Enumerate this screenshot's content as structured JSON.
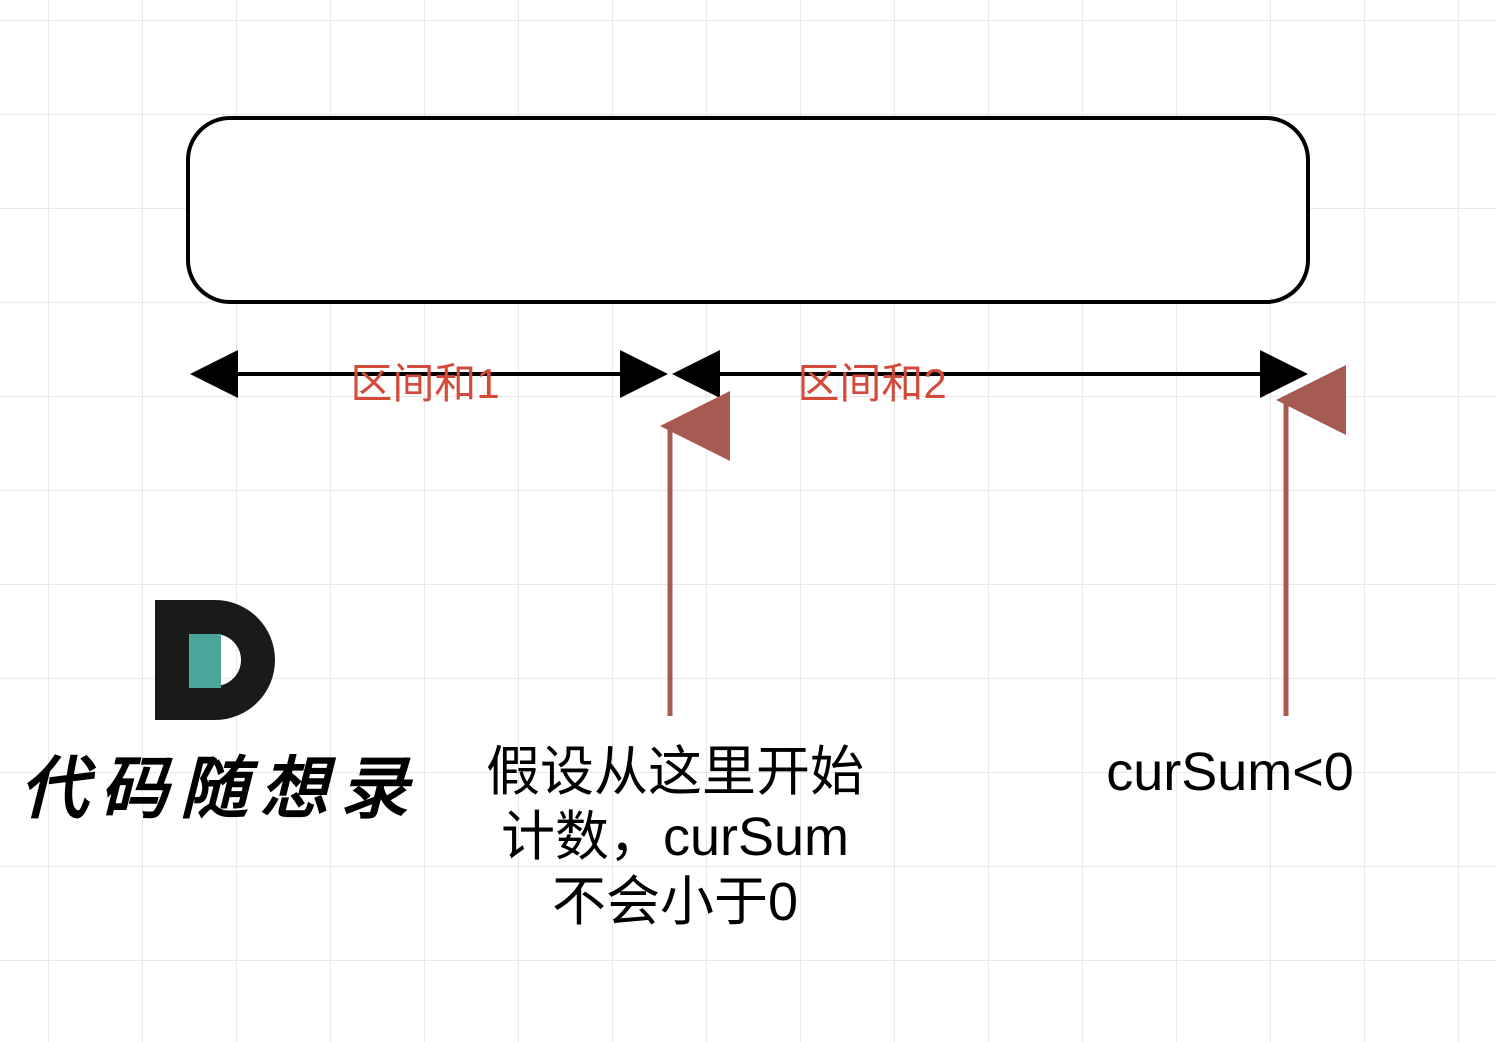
{
  "intervals": {
    "label1": "区间和1",
    "label2": "区间和2"
  },
  "annotations": {
    "left": {
      "line1": "假设从这里开始",
      "line2": "计数，curSum",
      "line3": "不会小于0"
    },
    "right": "curSum<0"
  },
  "logo": {
    "text": "代码随想录"
  },
  "colors": {
    "interval": "#d34a3a",
    "arrow": "#a65a52",
    "stroke": "#000000"
  }
}
